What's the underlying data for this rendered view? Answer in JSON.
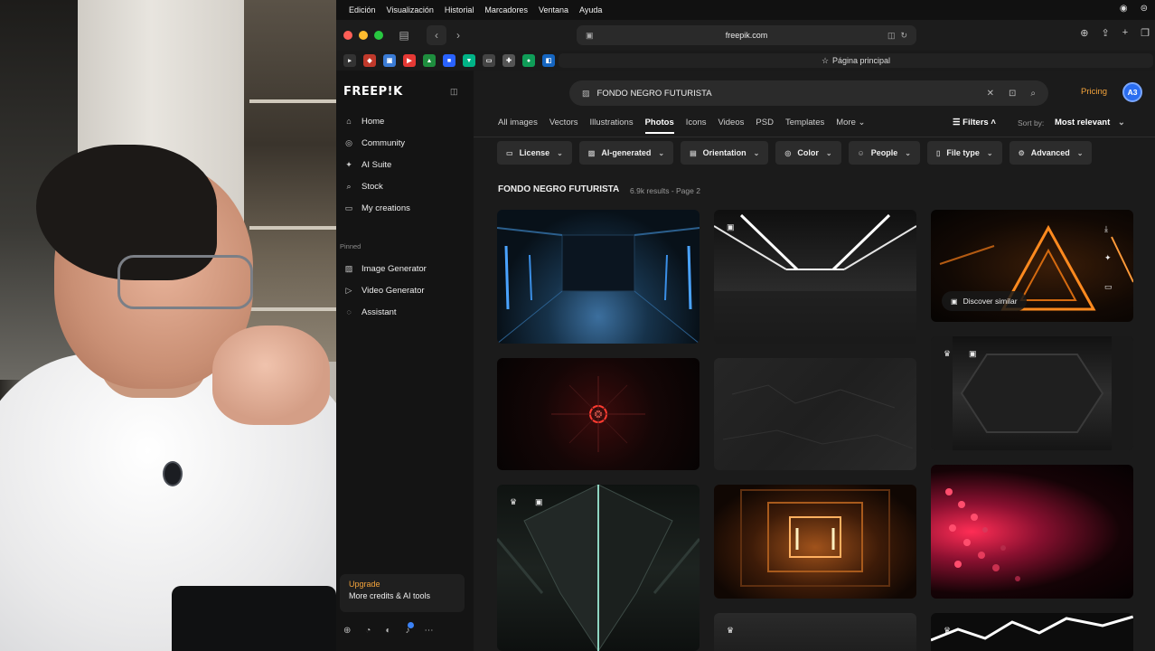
{
  "menubar": {
    "items": [
      "Edición",
      "Visualización",
      "Historial",
      "Marcadores",
      "Ventana",
      "Ayuda"
    ]
  },
  "browser": {
    "url": "freepik.com",
    "start_page": "Página principal",
    "traffic_colors": [
      "#ff5f57",
      "#febc2e",
      "#28c840"
    ]
  },
  "sidebar": {
    "logo": "FREEP!K",
    "nav": [
      {
        "label": "Home",
        "icon": "home-icon"
      },
      {
        "label": "Community",
        "icon": "community-icon"
      },
      {
        "label": "AI Suite",
        "icon": "sparkle-icon"
      },
      {
        "label": "Stock",
        "icon": "search-icon"
      },
      {
        "label": "My creations",
        "icon": "folder-icon"
      }
    ],
    "pinned_label": "Pinned",
    "pinned": [
      {
        "label": "Image Generator",
        "icon": "image-icon"
      },
      {
        "label": "Video Generator",
        "icon": "video-icon"
      },
      {
        "label": "Assistant",
        "icon": "assistant-icon"
      }
    ],
    "upgrade_title": "Upgrade",
    "upgrade_sub": "More credits & AI tools"
  },
  "header": {
    "search_value": "FONDO NEGRO FUTURISTA",
    "pricing": "Pricing",
    "avatar_initials": "A3",
    "accent": "#f3a33b"
  },
  "tabs": [
    "All images",
    "Vectors",
    "Illustrations",
    "Photos",
    "Icons",
    "Videos",
    "PSD",
    "Templates",
    "More"
  ],
  "active_tab": "Photos",
  "filters_label": "Filters",
  "sort": {
    "label": "Sort by:",
    "value": "Most relevant"
  },
  "chips": [
    "License",
    "AI-generated",
    "Orientation",
    "Color",
    "People",
    "File type",
    "Advanced"
  ],
  "results": {
    "title": "FONDO NEGRO FUTURISTA",
    "meta": "6.9k results - Page 2",
    "discover_label": "Discover similar"
  }
}
